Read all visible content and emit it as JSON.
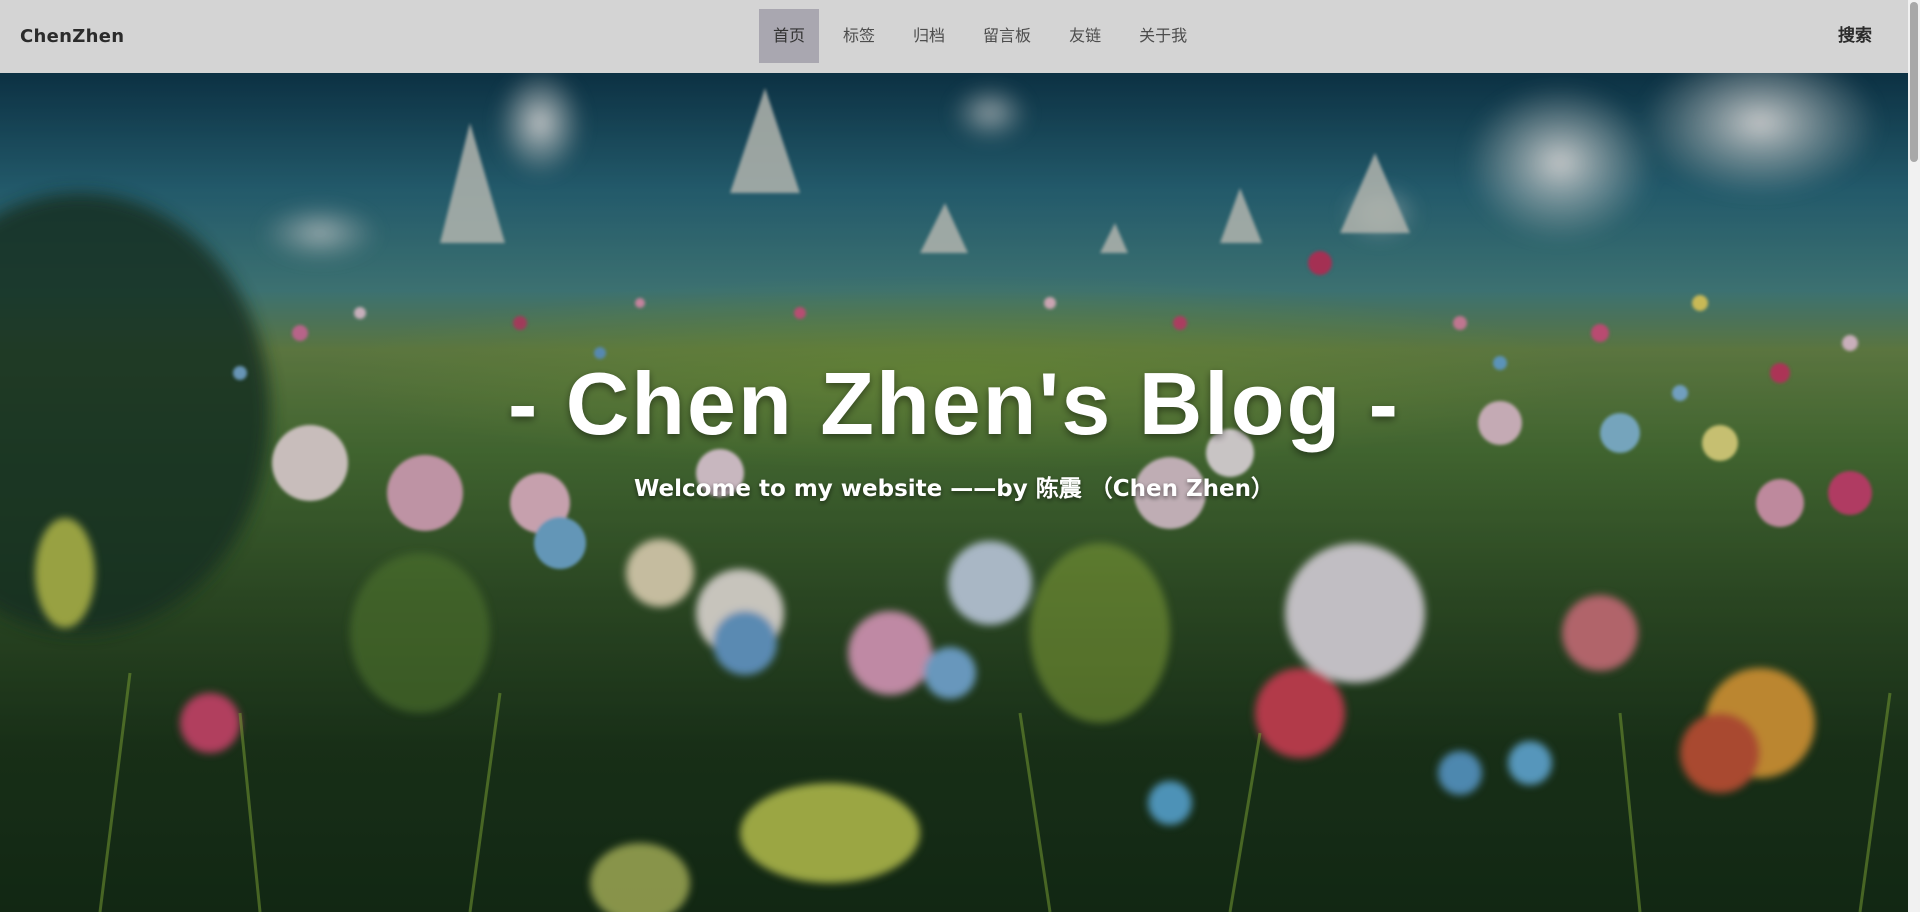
{
  "navbar": {
    "brand": "ChenZhen",
    "links": [
      {
        "label": "首页",
        "active": true
      },
      {
        "label": "标签",
        "active": false
      },
      {
        "label": "归档",
        "active": false
      },
      {
        "label": "留言板",
        "active": false
      },
      {
        "label": "友链",
        "active": false
      },
      {
        "label": "关于我",
        "active": false
      }
    ],
    "search_label": "搜索"
  },
  "hero": {
    "title": "- Chen Zhen's Blog -",
    "subtitle": "Welcome to my website ——by 陈震 （Chen Zhen）",
    "background_description_icon": "flower-meadow-image"
  },
  "colors": {
    "navbar_bg": "#d4d4d4",
    "active_tab_bg": "#a9a7b0",
    "hero_text": "#ffffff"
  }
}
